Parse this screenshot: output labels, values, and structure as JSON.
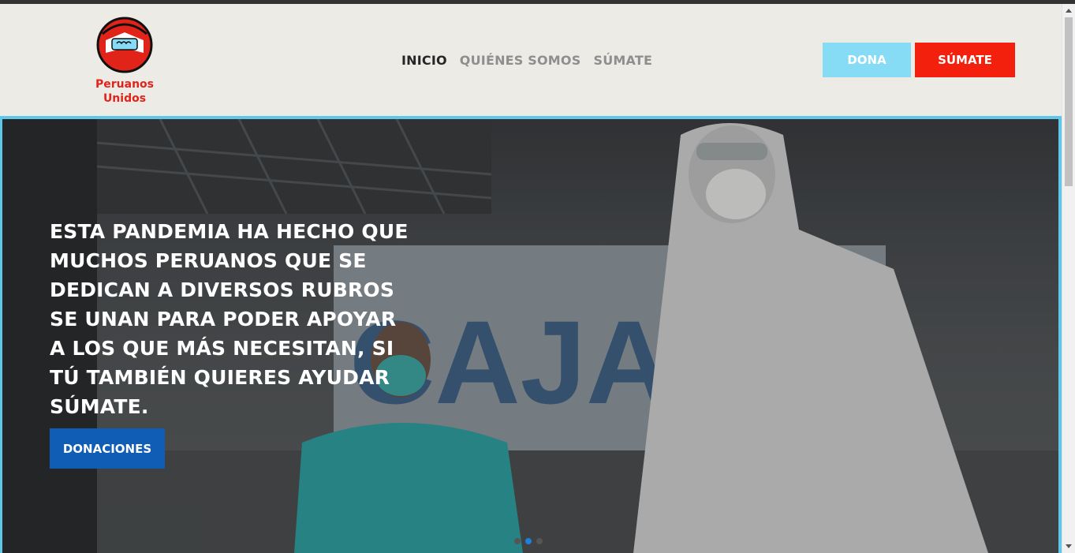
{
  "brand": {
    "name_line1": "Peruanos",
    "name_line2": "Unidos",
    "accent_red": "#e2231a",
    "accent_blue": "#86dbf5"
  },
  "nav": {
    "items": [
      "INICIO",
      "QUIÉNES SOMOS",
      "SÚMATE"
    ],
    "active": "INICIO"
  },
  "header_buttons": {
    "dona": "DONA",
    "sumate": "SÚMATE"
  },
  "hero": {
    "text": "ESTA PANDEMIA HA HECHO QUE MUCHOS PERUANOS QUE SE DEDICAN A DIVERSOS RUBROS SE UNAN PARA PODER APOYAR A LOS QUE MÁS NECESITAN, SI TÚ TAMBIÉN QUIERES AYUDAR SÚMATE.",
    "button": "DONACIONES",
    "slides_total": 3,
    "slide_active": 2
  }
}
